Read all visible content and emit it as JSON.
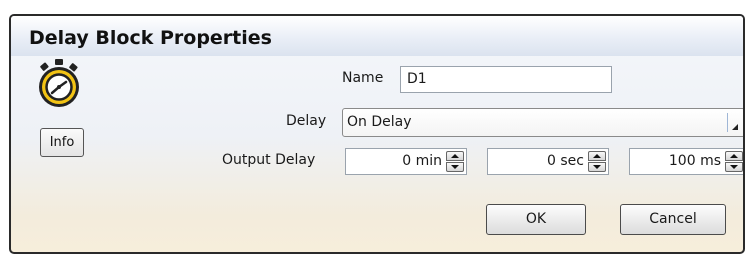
{
  "window": {
    "title": "Delay Block Properties"
  },
  "icon": {
    "name": "stopwatch-icon",
    "color": "#f2c314"
  },
  "info_button": {
    "label": "Info"
  },
  "name": {
    "label": "Name",
    "value": "D1"
  },
  "delay": {
    "label": "Delay",
    "selected": "On Delay"
  },
  "output_delay": {
    "label": "Output Delay",
    "minutes": "0 min",
    "seconds": "0 sec",
    "milliseconds": "100 ms"
  },
  "buttons": {
    "ok": "OK",
    "cancel": "Cancel"
  }
}
